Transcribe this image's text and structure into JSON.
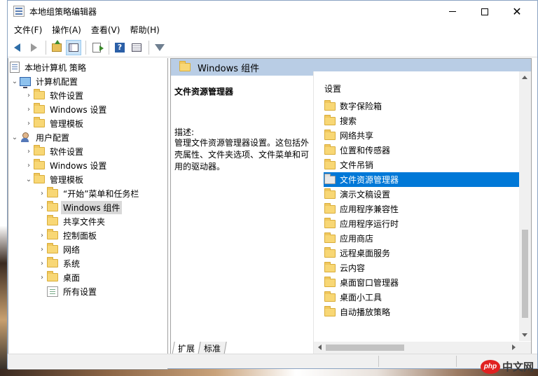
{
  "window": {
    "title": "本地组策略编辑器"
  },
  "menu": {
    "file": "文件(F)",
    "action": "操作(A)",
    "view": "查看(V)",
    "help": "帮助(H)"
  },
  "toolbar": {
    "icons": [
      "back-icon",
      "forward-icon",
      "up-folder-icon",
      "show-hide-tree-icon",
      "export-list-icon",
      "help-icon",
      "properties-icon",
      "filter-icon"
    ]
  },
  "tree": {
    "root": "本地计算机 策略",
    "computer_config": "计算机配置",
    "cc_software": "软件设置",
    "cc_windows": "Windows 设置",
    "cc_admin": "管理模板",
    "user_config": "用户配置",
    "uc_software": "软件设置",
    "uc_windows": "Windows 设置",
    "uc_admin": "管理模板",
    "start_menu": "“开始”菜单和任务栏",
    "windows_components": "Windows 组件",
    "shared_folders": "共享文件夹",
    "control_panel": "控制面板",
    "network": "网络",
    "system": "系统",
    "desktop": "桌面",
    "all_settings": "所有设置"
  },
  "detail": {
    "header": "Windows 组件",
    "title": "文件资源管理器",
    "desc_label": "描述:",
    "desc_text": "管理文件资源管理器设置。这包括外壳属性、文件夹选项、文件菜单和可用的驱动器。",
    "list_header": "设置",
    "items": [
      "数字保险箱",
      "搜索",
      "网络共享",
      "位置和传感器",
      "文件吊销",
      "文件资源管理器",
      "演示文稿设置",
      "应用程序兼容性",
      "应用程序运行时",
      "应用商店",
      "远程桌面服务",
      "云内容",
      "桌面窗口管理器",
      "桌面小工具",
      "自动播放策略"
    ],
    "selected_index": 5
  },
  "tabs": {
    "extended": "扩展",
    "standard": "标准"
  },
  "watermark": {
    "logo": "php",
    "text": "中文网"
  },
  "colors": {
    "selection": "#0078d7",
    "header_bg": "#b9cde5",
    "folder": "#f8d775"
  }
}
